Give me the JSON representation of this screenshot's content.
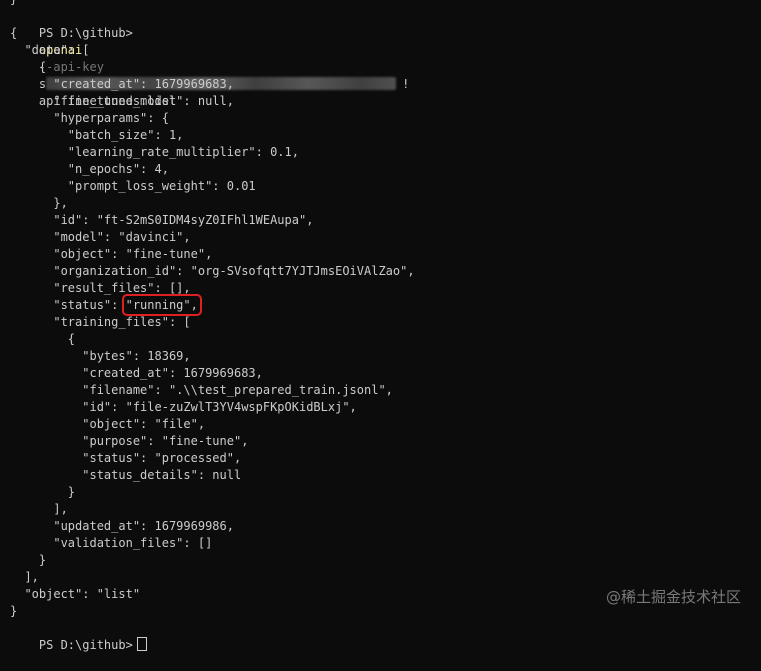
{
  "terminal": {
    "top_fragment": "}",
    "prompt": "PS D:\\github>",
    "command": "openai",
    "flag": "--api-key",
    "key_partial": "s",
    "key_end": "!",
    "args": "api fine_tunes.list",
    "lines": [
      "{",
      "  \"data\": [",
      "    {",
      "      \"created_at\": 1679969683,",
      "      \"fine_tuned_model\": null,",
      "      \"hyperparams\": {",
      "        \"batch_size\": 1,",
      "        \"learning_rate_multiplier\": 0.1,",
      "        \"n_epochs\": 4,",
      "        \"prompt_loss_weight\": 0.01",
      "      },",
      "      \"id\": \"ft-S2mS0IDM4syZ0IFhl1WEAupa\",",
      "      \"model\": \"davinci\",",
      "      \"object\": \"fine-tune\",",
      "      \"organization_id\": \"org-SVsofqtt7YJTJmsEOiVAlZao\",",
      "      \"result_files\": [],",
      "      \"status\": ",
      "      \"training_files\": [",
      "        {",
      "          \"bytes\": 18369,",
      "          \"created_at\": 1679969683,",
      "          \"filename\": \".\\\\test_prepared_train.jsonl\",",
      "          \"id\": \"file-zuZwlT3YV4wspFKpOKidBLxj\",",
      "          \"object\": \"file\",",
      "          \"purpose\": \"fine-tune\",",
      "          \"status\": \"processed\",",
      "          \"status_details\": null",
      "        }",
      "      ],",
      "      \"updated_at\": 1679969986,",
      "      \"validation_files\": []",
      "    }",
      "  ],",
      "  \"object\": \"list\"",
      "}"
    ],
    "status_value": "\"running\",",
    "bottom_prompt": "PS D:\\github>"
  },
  "watermark": "@稀土掘金技术社区",
  "colors": {
    "background": "#0c0c0c",
    "text": "#cccccc",
    "command": "#f9f1a5",
    "flag": "#767676",
    "highlight_box": "#e02020"
  }
}
